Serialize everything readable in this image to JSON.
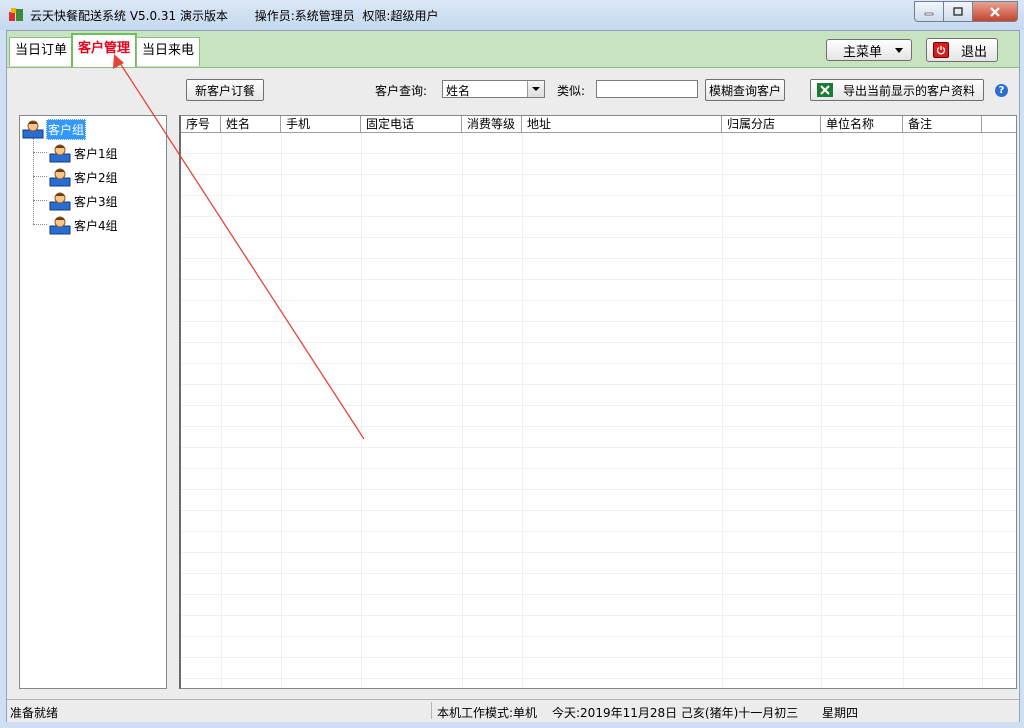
{
  "window": {
    "title": "云天快餐配送系统 V5.0.31 演示版本",
    "operator": "操作员:系统管理员",
    "permission": "权限:超级用户"
  },
  "tabs": [
    {
      "label": "当日订单",
      "active": false
    },
    {
      "label": "客户管理",
      "active": true
    },
    {
      "label": "当日来电",
      "active": false
    }
  ],
  "header_buttons": {
    "main_menu": "主菜单",
    "exit": "退出"
  },
  "toolbar": {
    "new_order": "新客户订餐",
    "query_label": "客户查询:",
    "query_field_value": "姓名",
    "similar_label": "类似:",
    "similar_value": "",
    "fuzzy_search": "模糊查询客户",
    "export": "导出当前显示的客户资料",
    "help_glyph": "?"
  },
  "tree": {
    "root": "客户组",
    "children": [
      "客户1组",
      "客户2组",
      "客户3组",
      "客户4组"
    ]
  },
  "table": {
    "columns": [
      "序号",
      "姓名",
      "手机",
      "固定电话",
      "消费等级",
      "地址",
      "归属分店",
      "单位名称",
      "备注"
    ],
    "rows": []
  },
  "status": {
    "left": "准备就绪",
    "mode": "本机工作模式:单机",
    "date": "今天:2019年11月28日 己亥(猪年)十一月初三",
    "weekday": "星期四"
  },
  "colors": {
    "active_tab_text": "#e8001c",
    "tab_strip_bg": "#c8e3bf",
    "annotation_arrow": "#e5443a",
    "tree_selected_bg": "#3399ff"
  }
}
